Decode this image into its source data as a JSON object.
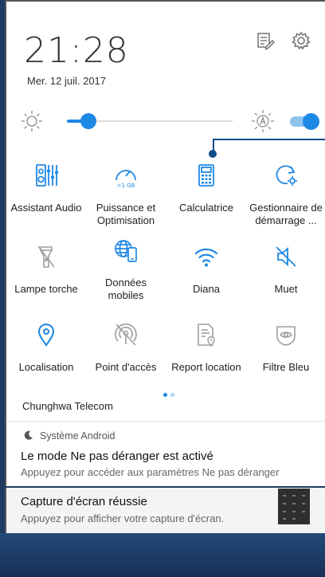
{
  "header": {
    "time": "21:28",
    "date": "Mer. 12 juil. 2017",
    "icons": [
      "edit-notes-icon",
      "settings-gear-icon"
    ]
  },
  "brightness": {
    "level": 0.13,
    "auto_toggle_on": true,
    "icons": [
      "sun-icon",
      "auto-brightness-icon"
    ]
  },
  "tiles": [
    {
      "label": "Assistant Audio",
      "icon": "audio-equalizer-icon",
      "active": true
    },
    {
      "label": "Puissance et Optimisation",
      "icon": "speedometer-icon",
      "active": true
    },
    {
      "label": "Calculatrice",
      "icon": "calculator-icon",
      "active": true
    },
    {
      "label": "Gestionnaire de démarrage ...",
      "icon": "startup-manager-icon",
      "active": true
    },
    {
      "label": "Lampe torche",
      "icon": "flashlight-icon",
      "active": false
    },
    {
      "label": "Données mobiles",
      "icon": "mobile-data-icon",
      "active": true
    },
    {
      "label": "Diana",
      "icon": "wifi-icon",
      "active": true
    },
    {
      "label": "Muet",
      "icon": "mute-icon",
      "active": true
    },
    {
      "label": "Localisation",
      "icon": "location-icon",
      "active": true
    },
    {
      "label": "Point d'accès",
      "icon": "hotspot-icon",
      "active": false
    },
    {
      "label": "Report location",
      "icon": "report-location-icon",
      "active": false
    },
    {
      "label": "Filtre Bleu",
      "icon": "blue-filter-icon",
      "active": false
    }
  ],
  "pager": {
    "pages": 2,
    "current": 1
  },
  "carrier": "Chunghwa Telecom",
  "notifications": [
    {
      "app": "Système Android",
      "title": "Le mode Ne pas déranger est activé",
      "text": "Appuyez pour accéder aux paramètres Ne pas déranger"
    },
    {
      "title": "Capture d'écran réussie",
      "text": "Appuyez pour afficher votre capture d'écran."
    }
  ],
  "colors": {
    "accent": "#1e88e5",
    "inactive_icon": "#9e9e9e",
    "callout": "#0d4e87"
  }
}
